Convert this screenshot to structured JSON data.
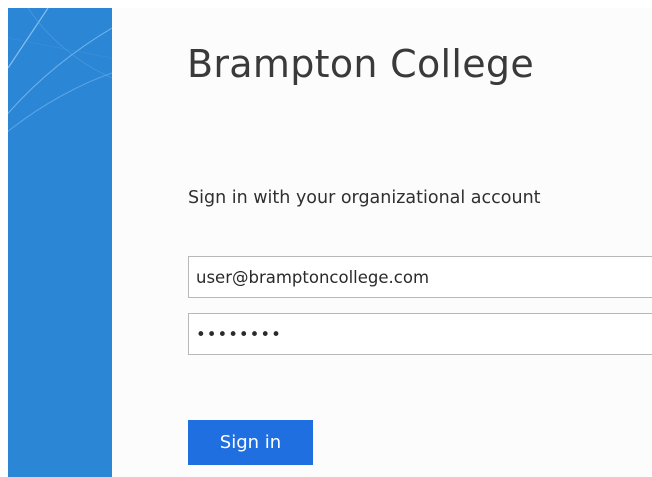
{
  "brand": {
    "title": "Brampton College"
  },
  "login": {
    "subtitle": "Sign in with your organizational account",
    "username_value": "user@bramptoncollege.com",
    "password_value": "password",
    "signin_label": "Sign in"
  },
  "colors": {
    "sidebar": "#2c86d6",
    "button": "#1f6fe0",
    "button_text": "#ffffff"
  }
}
